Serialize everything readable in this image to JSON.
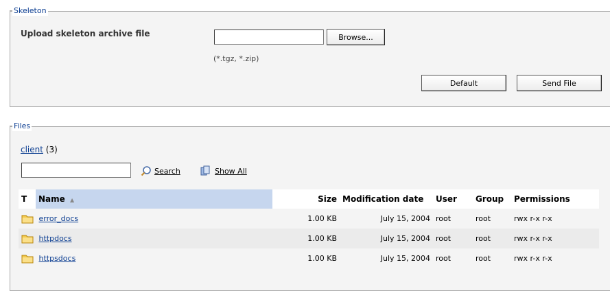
{
  "skeleton": {
    "legend": "Skeleton",
    "upload_label": "Upload skeleton archive file",
    "file_value": "",
    "browse_label": "Browse...",
    "hint": "(*.tgz, *.zip)",
    "default_label": "Default",
    "send_label": "Send File"
  },
  "files": {
    "legend": "Files",
    "path_link": "client",
    "path_count": "(3)",
    "search_value": "",
    "search_label": "Search",
    "show_all_label": "Show All",
    "columns": {
      "type": "T",
      "name": "Name",
      "sort_indicator": "▲",
      "size": "Size",
      "date": "Modification date",
      "user": "User",
      "group": "Group",
      "permissions": "Permissions"
    },
    "rows": [
      {
        "icon": "folder-icon",
        "name": "error_docs",
        "size": "1.00 KB",
        "date": "July 15, 2004",
        "user": "root",
        "group": "root",
        "permissions": "rwx r-x r-x"
      },
      {
        "icon": "folder-icon",
        "name": "httpdocs",
        "size": "1.00 KB",
        "date": "July 15, 2004",
        "user": "root",
        "group": "root",
        "permissions": "rwx r-x r-x"
      },
      {
        "icon": "folder-icon",
        "name": "httpsdocs",
        "size": "1.00 KB",
        "date": "July 15, 2004",
        "user": "root",
        "group": "root",
        "permissions": "rwx r-x r-x"
      }
    ]
  },
  "colors": {
    "link": "#0b3d91",
    "sorted_header": "#c6d6ee",
    "panel": "#f4f4f4",
    "folder": "#f2c94c"
  }
}
